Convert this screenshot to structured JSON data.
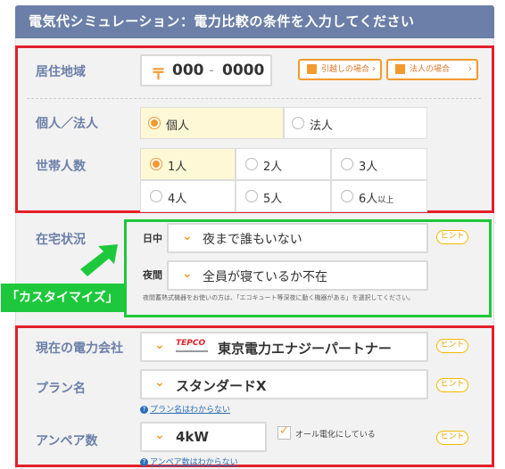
{
  "header": {
    "title": "電気代シミュレーション：電力比較の条件を入力してください"
  },
  "region": {
    "label": "居住地域",
    "postal_symbol": "〒",
    "postal_first": "000",
    "postal_sep": "-",
    "postal_last": "0000",
    "move_button": "引越しの場合",
    "corp_button": "法人の場合"
  },
  "entity": {
    "label": "個人／法人",
    "options": [
      "個人",
      "法人"
    ]
  },
  "household": {
    "label": "世帯人数",
    "options": [
      "1人",
      "2人",
      "3人",
      "4人",
      "5人",
      "6人"
    ],
    "last_suffix": "以上"
  },
  "home_status": {
    "label": "在宅状況",
    "day_label": "日中",
    "day_value": "夜まで誰もいない",
    "night_label": "夜間",
    "night_value": "全員が寝ているか不在",
    "note": "夜間蓄熱式機器をお使いの方は、「エコキュート等深夜に動く機器がある」を選択してください。",
    "hint": "ヒント"
  },
  "custom_tag": "「カスタイマイズ」",
  "company": {
    "label": "現在の電力会社",
    "logo_text": "TEPCO",
    "value": "東京電力エナジーパートナー",
    "hint": "ヒント"
  },
  "plan": {
    "label": "プラン名",
    "value": "スタンダードX",
    "help": "プラン名はわからない",
    "hint": "ヒント"
  },
  "ampere": {
    "label": "アンペア数",
    "value": "4kW",
    "checkbox_label": "オール電化にしている",
    "help": "アンペア数はわからない",
    "hint": "ヒント"
  },
  "colors": {
    "header": "#6b7fa8",
    "accent": "#f29a2e",
    "red_frame": "#e3202a",
    "green_frame": "#1ec83c"
  }
}
